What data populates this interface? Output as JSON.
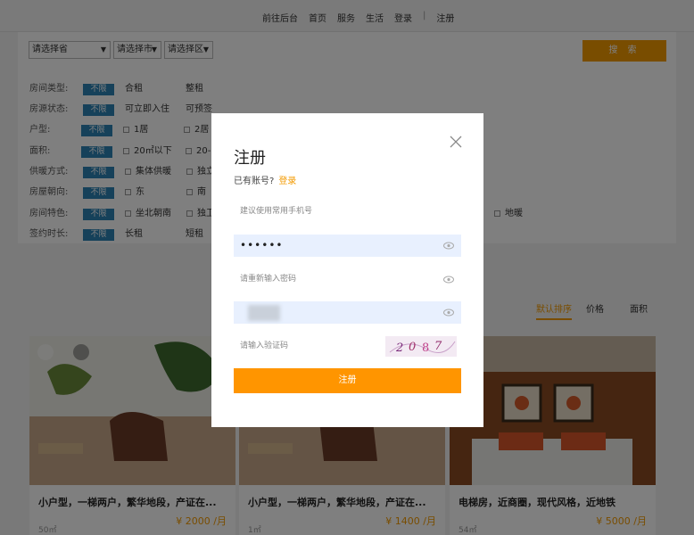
{
  "nav": {
    "items": [
      "前往后台",
      "首页",
      "服务",
      "生活",
      "登录",
      "|",
      "注册"
    ]
  },
  "filters": {
    "province": "请选择省",
    "city": "请选择市",
    "district": "请选择区",
    "search_label": "搜 索",
    "rows": [
      {
        "label": "房间类型:",
        "tag": "不限",
        "options": [
          "合租",
          "整租"
        ],
        "checkbox": false
      },
      {
        "label": "房源状态:",
        "tag": "不限",
        "options": [
          "可立即入住",
          "可预签"
        ],
        "checkbox": false
      },
      {
        "label": "户型:",
        "tag": "不限",
        "options": [
          "1居",
          "2居"
        ],
        "checkbox": true
      },
      {
        "label": "面积:",
        "tag": "不限",
        "options": [
          "20㎡以下",
          "20-"
        ],
        "checkbox": true
      },
      {
        "label": "供暖方式:",
        "tag": "不限",
        "options": [
          "集体供暖",
          "独立"
        ],
        "checkbox": true
      },
      {
        "label": "房屋朝向:",
        "tag": "不限",
        "options": [
          "东",
          "南"
        ],
        "checkbox": true
      },
      {
        "label": "房间特色:",
        "tag": "不限",
        "options": [
          "坐北朝南",
          "独卫"
        ],
        "checkbox": true,
        "extra": "地暖"
      },
      {
        "label": "签约时长:",
        "tag": "不限",
        "options": [
          "长租",
          "短租"
        ],
        "checkbox": false
      }
    ]
  },
  "sort": {
    "default": "默认排序",
    "price": "价格",
    "area": "面积"
  },
  "listings": [
    {
      "title": "小户型，一梯两户，繁华地段，产证在...",
      "price": "¥ 2000 /月",
      "area": "50㎡"
    },
    {
      "title": "小户型，一梯两户，繁华地段，产证在...",
      "price": "¥ 1400 /月",
      "area": "1㎡"
    },
    {
      "title": "电梯房，近商圈，现代风格，近地铁",
      "price": "¥ 5000 /月",
      "area": "54㎡"
    }
  ],
  "register": {
    "title": "注册",
    "has_account": "已有账号?",
    "login_link": "登录",
    "phone_placeholder": "建议使用常用手机号",
    "password_value": "••••••",
    "repeat_placeholder": "请重新输入密码",
    "captcha_placeholder": "请输入验证码",
    "submit_label": "注册"
  },
  "colors": {
    "accent": "#f39a00",
    "tag_blue": "#2d83b5",
    "filled_field": "#e8f0fe"
  }
}
